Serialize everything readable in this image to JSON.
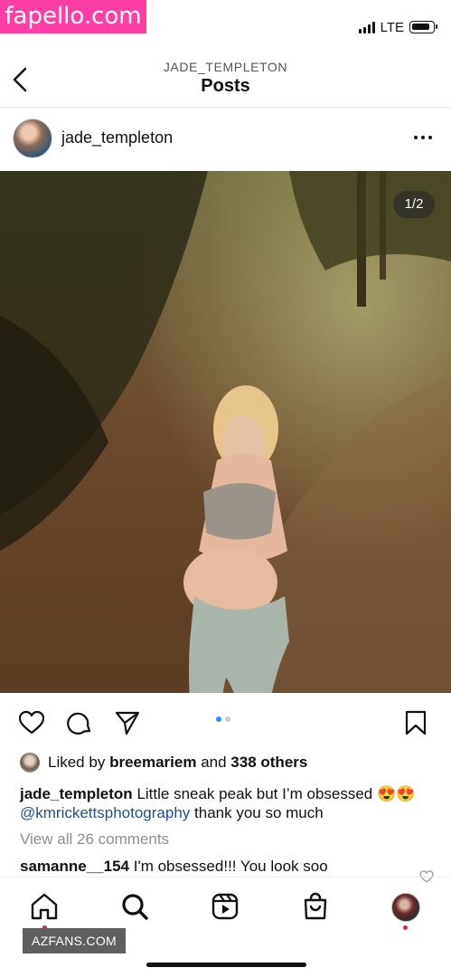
{
  "watermarks": {
    "top": "fapello.com",
    "bottom": "AZFANS.COM"
  },
  "status_bar": {
    "network": "LTE"
  },
  "header": {
    "username": "JADE_TEMPLETON",
    "title": "Posts"
  },
  "post": {
    "username": "jade_templeton",
    "image_counter": "1/2",
    "carousel": {
      "count": 2,
      "active_index": 0
    },
    "likes": {
      "prefix": "Liked by",
      "liker": "breemariem",
      "joiner": "and",
      "others": "338 others"
    },
    "caption": {
      "username": "jade_templeton",
      "text": "Little sneak peak but I’m obsessed",
      "emojis": "😍😍",
      "mention": "@kmrickettsphotography",
      "text2": "thank you so much"
    },
    "view_comments": "View all 26 comments",
    "top_comment": {
      "username": "samanne__154",
      "text": "I'm obsessed!!! You look soo"
    }
  },
  "colors": {
    "accent_blue": "#1e90ff",
    "notification_red": "#e0244a",
    "watermark_pink": "#ff3ea5"
  },
  "icons": [
    "back-icon",
    "more-icon",
    "heart-icon",
    "comment-icon",
    "share-icon",
    "bookmark-icon",
    "home-icon",
    "search-icon",
    "reels-icon",
    "shop-icon"
  ]
}
